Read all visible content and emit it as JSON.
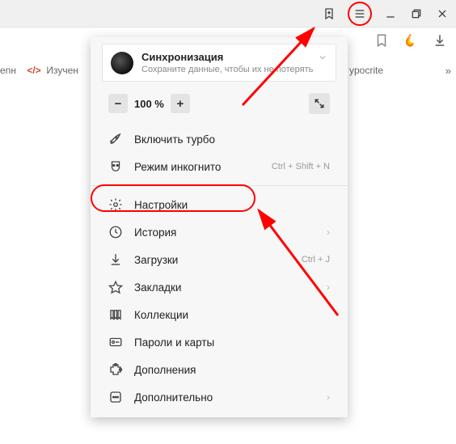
{
  "topbar": {},
  "bookmarks": {
    "left_fragment": "enн",
    "item1": "Изучен",
    "right_fragment": "ypocrite"
  },
  "sync": {
    "title": "Синхронизация",
    "subtitle": "Сохраните данные, чтобы их не потерять"
  },
  "zoom": {
    "minus": "−",
    "value": "100 %",
    "plus": "+"
  },
  "menu": {
    "turbo": "Включить турбо",
    "incognito": "Режим инкогнито",
    "incognito_shortcut": "Ctrl + Shift + N",
    "settings": "Настройки",
    "history": "История",
    "downloads": "Загрузки",
    "downloads_shortcut": "Ctrl + J",
    "bookmarks": "Закладки",
    "collections": "Коллекции",
    "passwords": "Пароли и карты",
    "addons": "Дополнения",
    "more": "Дополнительно"
  }
}
